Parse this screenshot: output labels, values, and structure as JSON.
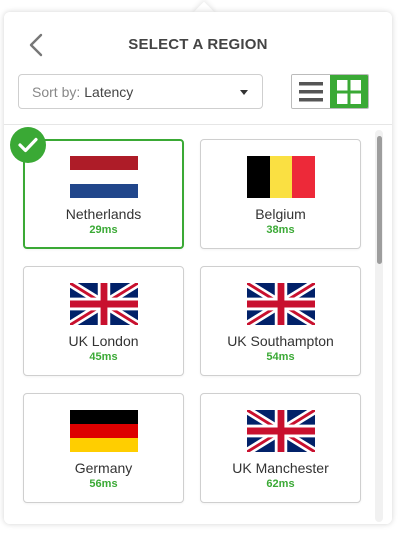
{
  "header": {
    "title": "SELECT A REGION",
    "back_icon": "chevron-left-icon"
  },
  "sort": {
    "prefix": "Sort by:",
    "value": "Latency"
  },
  "view_toggle": {
    "active": "grid",
    "options": [
      "list",
      "grid"
    ]
  },
  "colors": {
    "accent": "#3aa935",
    "border": "#cfcfcf",
    "text": "#333333"
  },
  "regions": [
    {
      "name": "Netherlands",
      "latency": "29ms",
      "flag": "netherlands-flag",
      "selected": true
    },
    {
      "name": "Belgium",
      "latency": "38ms",
      "flag": "belgium-flag",
      "selected": false
    },
    {
      "name": "UK London",
      "latency": "45ms",
      "flag": "uk-flag",
      "selected": false
    },
    {
      "name": "UK Southampton",
      "latency": "54ms",
      "flag": "uk-flag",
      "selected": false
    },
    {
      "name": "Germany",
      "latency": "56ms",
      "flag": "germany-flag",
      "selected": false
    },
    {
      "name": "UK Manchester",
      "latency": "62ms",
      "flag": "uk-flag",
      "selected": false
    }
  ]
}
